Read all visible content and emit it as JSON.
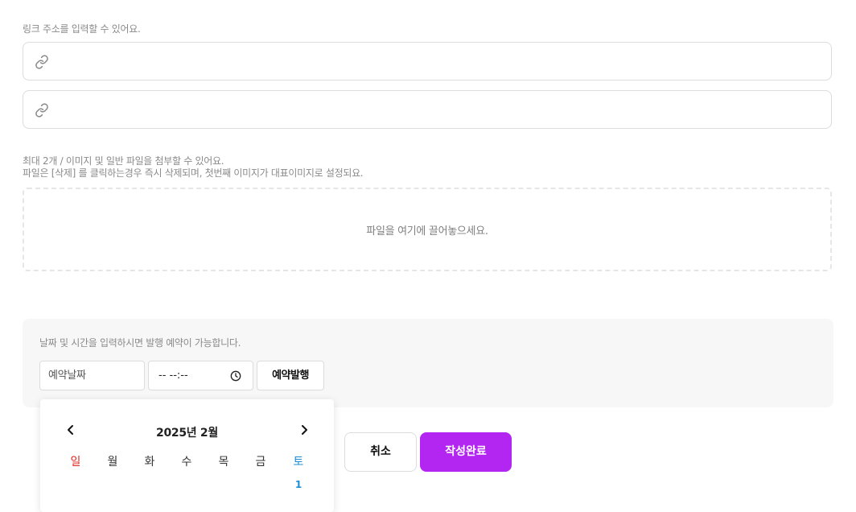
{
  "links": {
    "hint": "링크 주소를 입력할 수 있어요.",
    "fields": [
      {
        "value": "",
        "icon": "link-icon"
      },
      {
        "value": "",
        "icon": "link-icon"
      }
    ]
  },
  "attachments": {
    "hint_line1": "최대 2개 / 이미지 및 일반 파일을 첨부할 수 있어요.",
    "hint_line2": "파일은 [삭제] 를 클릭하는경우 즉시 삭제되며, 첫번째 이미지가 대표이미지로 설정되요.",
    "dropzone_text": "파일을 여기에 끌어놓으세요."
  },
  "schedule": {
    "hint": "날짜 및 시간을 입력하시면 발행 예약이 가능합니다.",
    "date_placeholder": "예약날짜",
    "time_value": "-- --:--",
    "button_label": "예약발행"
  },
  "calendar": {
    "title": "2025년 2월",
    "weekdays": [
      "일",
      "월",
      "화",
      "수",
      "목",
      "금",
      "토"
    ],
    "first_row_days": [
      "",
      "",
      "",
      "",
      "",
      "",
      "1"
    ],
    "colors": {
      "sunday": "#e0281f",
      "saturday": "#1e8fd6"
    }
  },
  "actions": {
    "cancel_label": "취소",
    "submit_label": "작성완료",
    "submit_color": "#b325f0"
  }
}
